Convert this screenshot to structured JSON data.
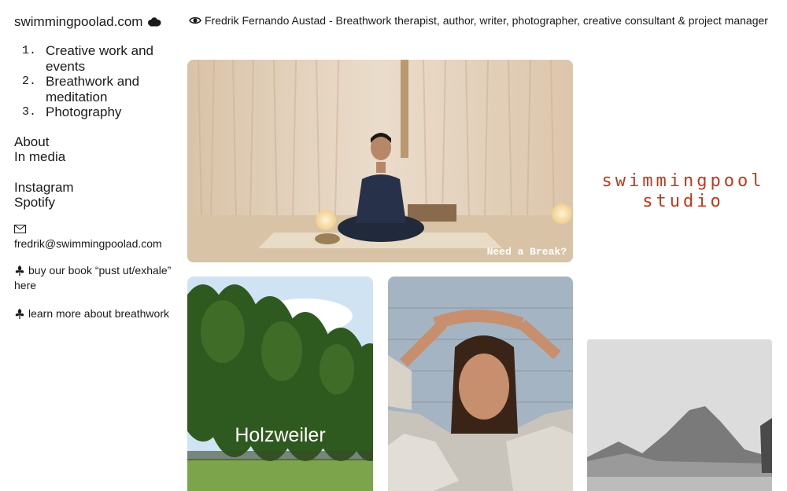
{
  "site": {
    "title": "swimmingpoolad.com",
    "icon": "cloud-icon"
  },
  "nav": [
    {
      "num": "1.",
      "label": "Creative work and events"
    },
    {
      "num": "2.",
      "label": "Breathwork and meditation"
    },
    {
      "num": "3.",
      "label": "Photography"
    }
  ],
  "links": {
    "about": "About",
    "in_media": "In media",
    "instagram": "Instagram",
    "spotify": "Spotify"
  },
  "contact": {
    "email": "fredrik@swimmingpoolad.com",
    "icon": "mail-icon"
  },
  "cta": {
    "book": "buy our book “pust ut/exhale” here",
    "breathwork": "learn more about breathwork"
  },
  "header": {
    "text": "Fredrik Fernando Austad - Breathwork therapist, author, writer, photographer, creative consultant & project manager",
    "icon": "eye-icon"
  },
  "gallery": {
    "hero_caption": "Need a Break?",
    "holzweiler_label": "Holzweiler",
    "logo_text_line1": "swimmingpool",
    "logo_text_line2": "studio"
  },
  "colors": {
    "logo": "#c0391b",
    "text": "#1a1a1a"
  }
}
